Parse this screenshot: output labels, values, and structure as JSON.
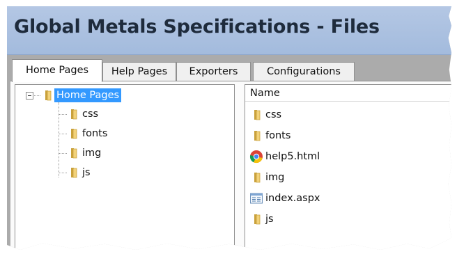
{
  "window": {
    "title": "Global Metals Specifications - Files"
  },
  "tabs": [
    {
      "label": "Home Pages",
      "active": true
    },
    {
      "label": "Help Pages",
      "active": false
    },
    {
      "label": "Exporters",
      "active": false
    },
    {
      "label": "Configurations",
      "active": false
    }
  ],
  "tree": {
    "root": {
      "label": "Home Pages",
      "icon": "folder-icon",
      "expanded": true,
      "selected": true
    },
    "children": [
      {
        "label": "css",
        "icon": "folder-icon"
      },
      {
        "label": "fonts",
        "icon": "folder-icon"
      },
      {
        "label": "img",
        "icon": "folder-icon"
      },
      {
        "label": "js",
        "icon": "folder-icon"
      }
    ]
  },
  "file_list": {
    "column_header": "Name",
    "items": [
      {
        "label": "css",
        "icon": "folder-icon"
      },
      {
        "label": "fonts",
        "icon": "folder-icon"
      },
      {
        "label": "help5.html",
        "icon": "chrome-icon"
      },
      {
        "label": "img",
        "icon": "folder-icon"
      },
      {
        "label": "index.aspx",
        "icon": "aspx-file-icon"
      },
      {
        "label": "js",
        "icon": "folder-icon"
      }
    ]
  },
  "colors": {
    "title_bar": "#a9bfe0",
    "selection": "#3399ff",
    "folder": "#e8c462"
  }
}
